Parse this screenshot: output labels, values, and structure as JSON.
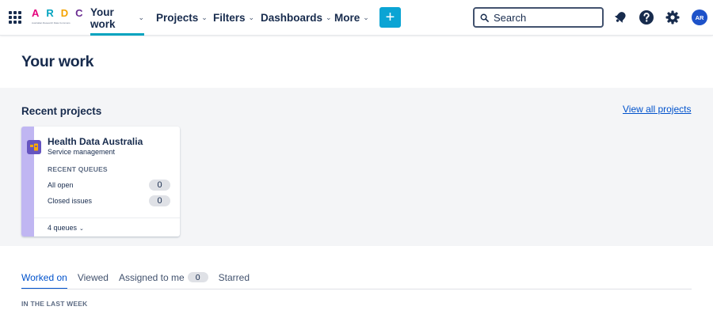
{
  "header": {
    "logo": {
      "letters": [
        "A",
        "R",
        "D",
        "C"
      ],
      "subtitle": "Australian Research Data Commons",
      "colors": [
        "#e5007d",
        "#00a3bf",
        "#f4a300",
        "#6a2c91"
      ]
    },
    "nav": [
      {
        "label": "Your work",
        "active": true
      },
      {
        "label": "Projects"
      },
      {
        "label": "Filters"
      },
      {
        "label": "Dashboards"
      },
      {
        "label": "More"
      }
    ],
    "create_label": "+",
    "search": {
      "placeholder": "Search"
    },
    "icons": [
      "apps-grid-icon",
      "notifications-icon",
      "help-icon",
      "settings-icon"
    ],
    "avatar_initials": "AR",
    "accent_color": "#00a3bf"
  },
  "page": {
    "title": "Your work"
  },
  "recent_projects": {
    "title": "Recent projects",
    "view_all_label": "View all projects",
    "projects": [
      {
        "name": "Health Data Australia",
        "type": "Service management",
        "queues_heading": "RECENT QUEUES",
        "queues": [
          {
            "label": "All open",
            "count": "0"
          },
          {
            "label": "Closed issues",
            "count": "0"
          }
        ],
        "footer_label": "4 queues",
        "stripe_color": "#c0b6f2",
        "icon_color": "#6554c0"
      }
    ]
  },
  "tabs": [
    {
      "label": "Worked on",
      "active": true
    },
    {
      "label": "Viewed"
    },
    {
      "label": "Assigned to me",
      "badge": "0"
    },
    {
      "label": "Starred"
    }
  ],
  "period_label": "IN THE LAST WEEK"
}
